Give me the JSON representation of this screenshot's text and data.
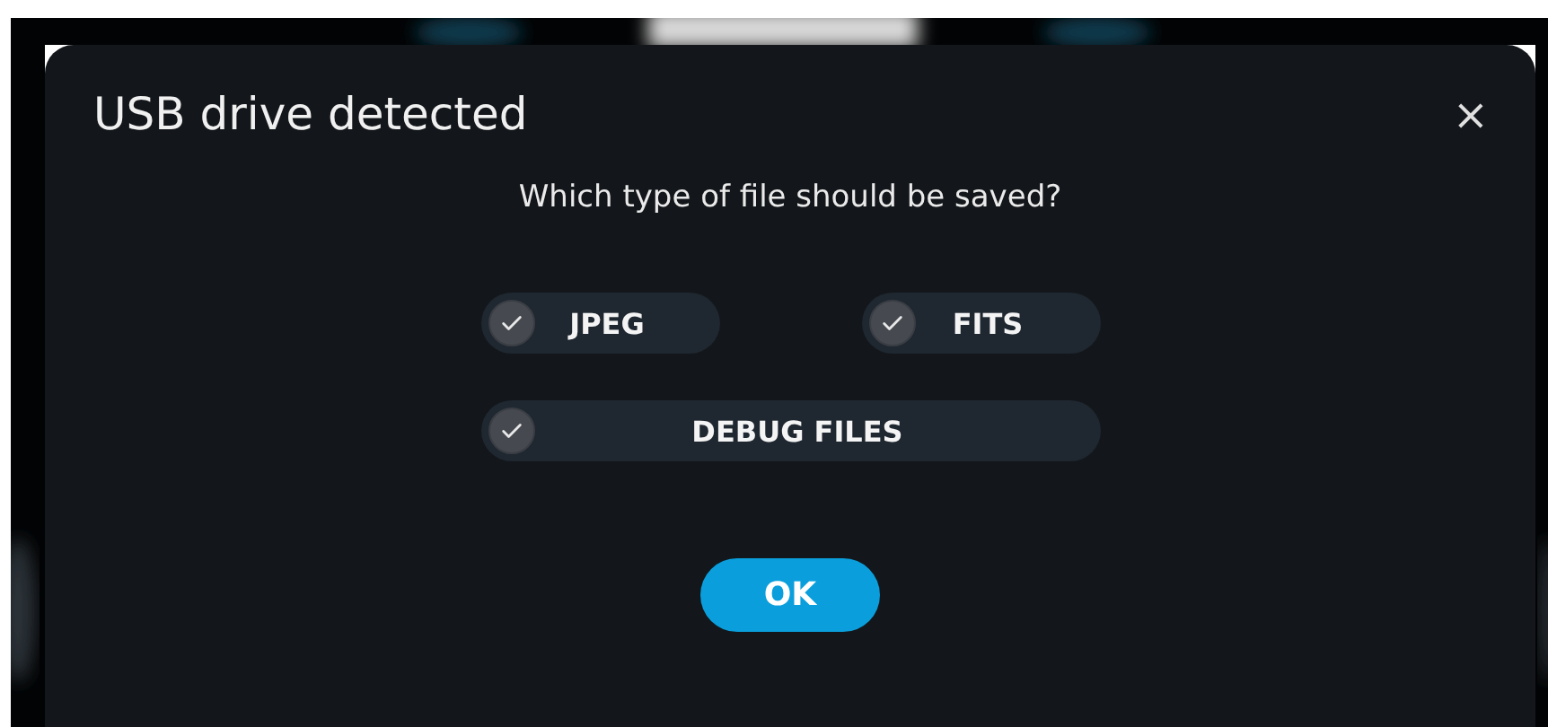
{
  "dialog": {
    "title": "USB drive detected",
    "close": "×",
    "question": "Which type of file should be saved?",
    "option_rows": [
      [
        {
          "label": "JPEG",
          "checked": true
        },
        {
          "label": "FITS",
          "checked": true
        }
      ],
      [
        {
          "label": "DEBUG FILES",
          "checked": true
        }
      ]
    ],
    "button": "OK"
  }
}
